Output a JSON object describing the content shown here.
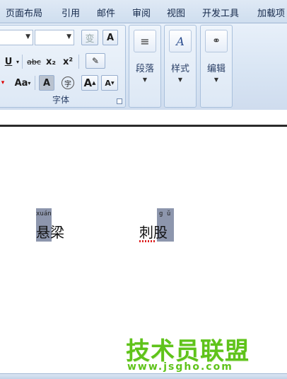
{
  "menu": {
    "tabs": [
      "页面布局",
      "引用",
      "邮件",
      "审阅",
      "视图",
      "开发工具",
      "加载项"
    ]
  },
  "ribbon": {
    "font_group": {
      "label": "字体",
      "btn_underline": "U",
      "btn_strike": "abc",
      "btn_subscript": "x₂",
      "btn_superscript": "x²",
      "btn_case": "Aa",
      "btn_charshade": "A",
      "btn_enclose": "字",
      "btn_grow": "A",
      "btn_shrink": "A",
      "btn_border": "A"
    },
    "paragraph_label": "段落",
    "styles_label": "样式",
    "editing_label": "编辑"
  },
  "document": {
    "word1": {
      "text": "悬梁",
      "pinyin": "xuán"
    },
    "word2": {
      "text": "刺股",
      "pinyin": "g ǔ"
    }
  },
  "watermark": {
    "cn": "技术员联盟",
    "url": "www.jsgho.com"
  },
  "colors": {
    "ribbon": "#dbe6f4",
    "highlight": "#8d96ad",
    "watermark": "#5fc31a"
  }
}
